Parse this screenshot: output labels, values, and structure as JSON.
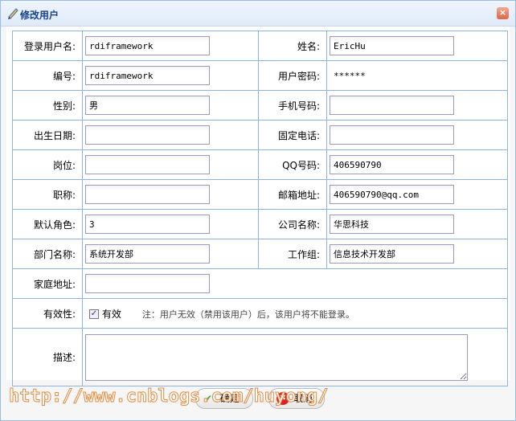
{
  "dialog": {
    "title": "修改用户",
    "close_label": "×"
  },
  "fields": [
    {
      "label": "登录用户名:",
      "value": "rdiframework",
      "label2": "姓名:",
      "value2": "EricHu"
    },
    {
      "label": "编号:",
      "value": "rdiframework",
      "label2": "用户密码:",
      "value2": "******"
    },
    {
      "label": "性别:",
      "value": "男",
      "label2": "手机号码:",
      "value2": ""
    },
    {
      "label": "出生日期:",
      "value": "",
      "label2": "固定电话:",
      "value2": ""
    },
    {
      "label": "岗位:",
      "value": "",
      "label2": "QQ号码:",
      "value2": "406590790"
    },
    {
      "label": "职称:",
      "value": "",
      "label2": "邮箱地址:",
      "value2": "406590790@qq.com"
    },
    {
      "label": "默认角色:",
      "value": "3",
      "label2": "公司名称:",
      "value2": "华思科技"
    },
    {
      "label": "部门名称:",
      "value": "系统开发部",
      "label2": "工作组:",
      "value2": "信息技术开发部"
    }
  ],
  "home_address": {
    "label": "家庭地址:",
    "value": ""
  },
  "validity": {
    "label": "有效性:",
    "checkbox_label": "有效",
    "checked": true,
    "note": "注：用户无效（禁用该用户）后，该用户将不能登录。"
  },
  "description": {
    "label": "描述:",
    "value": ""
  },
  "buttons": {
    "ok": "确定",
    "cancel": "取消"
  },
  "watermark": "http://www.cnblogs.com/huyong/"
}
